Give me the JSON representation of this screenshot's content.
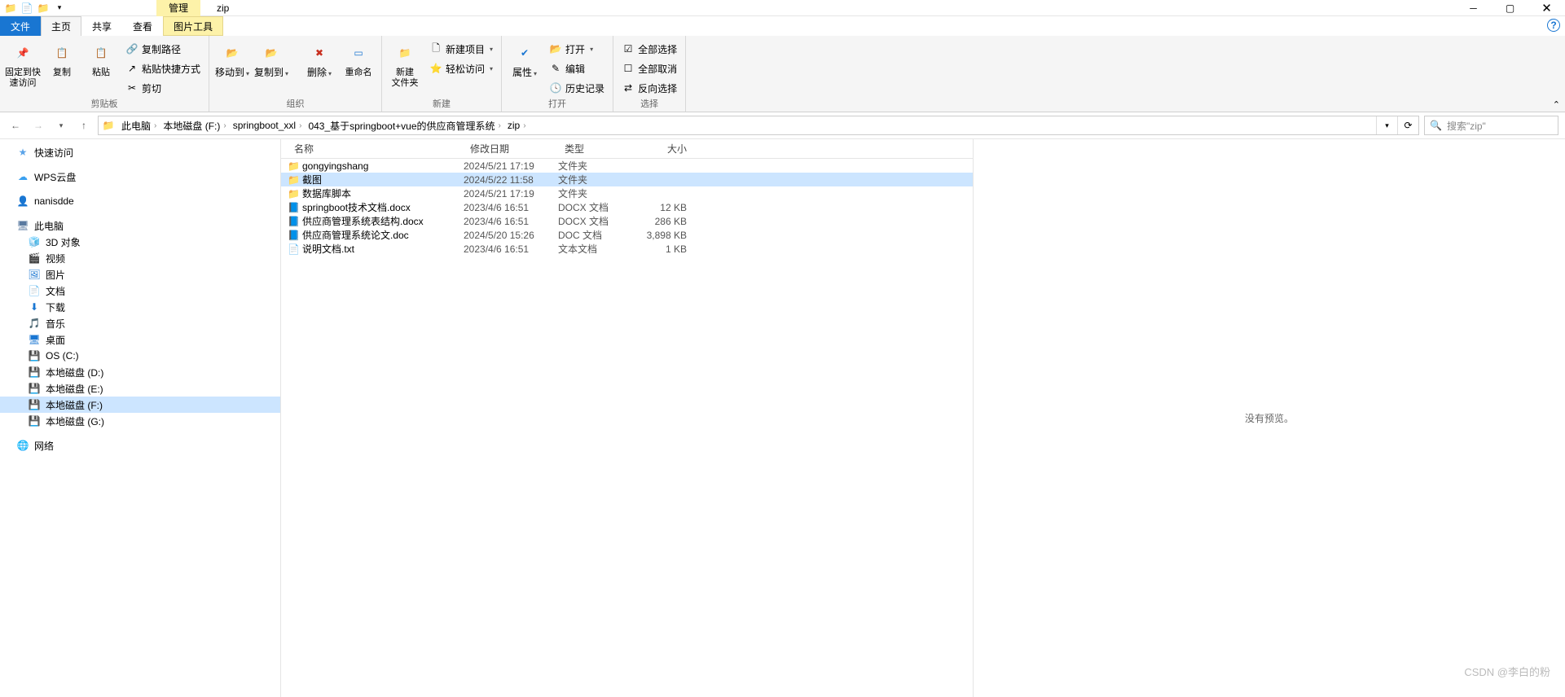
{
  "title_tab": "管理",
  "window_title": "zip",
  "tabs": {
    "file": "文件",
    "home": "主页",
    "share": "共享",
    "view": "查看",
    "pic": "图片工具"
  },
  "ribbon": {
    "clipboard": {
      "pin": "固定到快\n速访问",
      "copy": "复制",
      "paste": "粘贴",
      "copy_path": "复制路径",
      "paste_shortcut": "粘贴快捷方式",
      "cut": "剪切",
      "label": "剪贴板"
    },
    "organize": {
      "move": "移动到",
      "copy_to": "复制到",
      "delete": "删除",
      "rename": "重命名",
      "label": "组织"
    },
    "new": {
      "folder": "新建\n文件夹",
      "item": "新建项目",
      "easy": "轻松访问",
      "label": "新建"
    },
    "open": {
      "properties": "属性",
      "open": "打开",
      "edit": "编辑",
      "history": "历史记录",
      "label": "打开"
    },
    "select": {
      "all": "全部选择",
      "none": "全部取消",
      "invert": "反向选择",
      "label": "选择"
    }
  },
  "breadcrumbs": [
    "此电脑",
    "本地磁盘 (F:)",
    "springboot_xxl",
    "043_基于springboot+vue的供应商管理系统",
    "zip"
  ],
  "search_placeholder": "搜索\"zip\"",
  "sidebar": {
    "quick": "快速访问",
    "wps": "WPS云盘",
    "nan": "nanisdde",
    "pc": "此电脑",
    "pc_children": [
      "3D 对象",
      "视频",
      "图片",
      "文档",
      "下载",
      "音乐",
      "桌面",
      "OS (C:)",
      "本地磁盘 (D:)",
      "本地磁盘 (E:)",
      "本地磁盘 (F:)",
      "本地磁盘 (G:)"
    ],
    "network": "网络"
  },
  "columns": {
    "name": "名称",
    "date": "修改日期",
    "type": "类型",
    "size": "大小"
  },
  "files": [
    {
      "icon": "folder",
      "name": "gongyingshang",
      "date": "2024/5/21 17:19",
      "type": "文件夹",
      "size": ""
    },
    {
      "icon": "folder",
      "name": "截图",
      "date": "2024/5/22 11:58",
      "type": "文件夹",
      "size": "",
      "selected": true
    },
    {
      "icon": "folder",
      "name": "数据库脚本",
      "date": "2024/5/21 17:19",
      "type": "文件夹",
      "size": ""
    },
    {
      "icon": "docx",
      "name": "springboot技术文档.docx",
      "date": "2023/4/6 16:51",
      "type": "DOCX 文档",
      "size": "12 KB"
    },
    {
      "icon": "docx",
      "name": "供应商管理系统表结构.docx",
      "date": "2023/4/6 16:51",
      "type": "DOCX 文档",
      "size": "286 KB"
    },
    {
      "icon": "doc",
      "name": "供应商管理系统论文.doc",
      "date": "2024/5/20 15:26",
      "type": "DOC 文档",
      "size": "3,898 KB"
    },
    {
      "icon": "txt",
      "name": "说明文档.txt",
      "date": "2023/4/6 16:51",
      "type": "文本文档",
      "size": "1 KB"
    }
  ],
  "preview_text": "没有预览。",
  "watermark": "CSDN @李白的粉"
}
